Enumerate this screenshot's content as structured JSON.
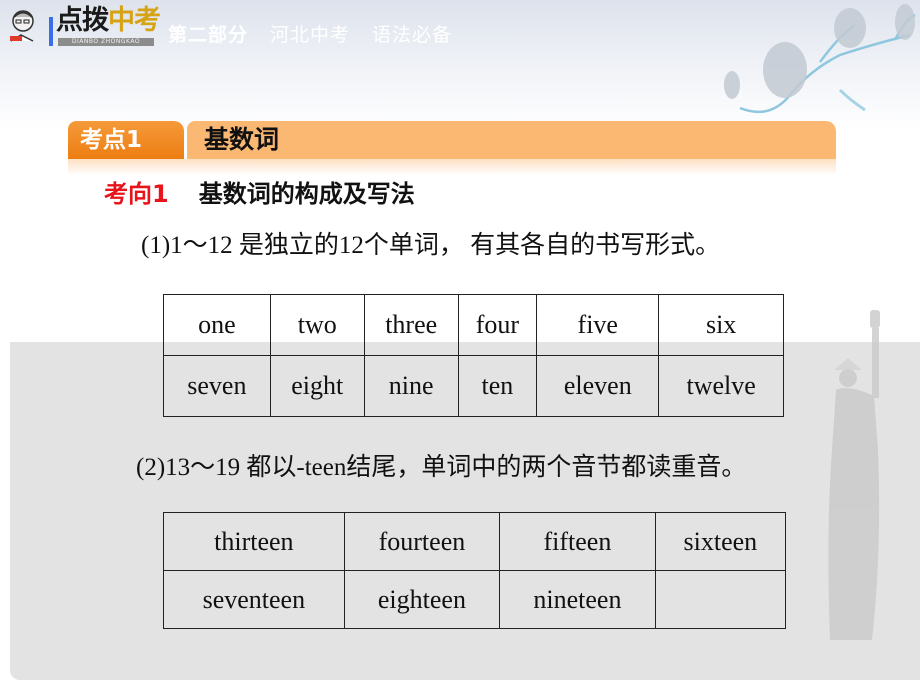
{
  "header": {
    "logo": {
      "main_black": "点拨",
      "main_gold": "中考",
      "subtitle": "DIANBO ZHONGKAO",
      "icon": "cartoon-teacher-icon"
    },
    "nav": [
      "第二部分",
      "河北中考",
      "语法必备"
    ]
  },
  "colors": {
    "accent_orange": "#ed7d12",
    "title_bar_orange": "#fbb872",
    "subhead_red": "#e8141b",
    "logo_blue": "#3a6ee8",
    "logo_gold": "#d6a316"
  },
  "section": {
    "tag": "考点1",
    "title": "基数词"
  },
  "subsection": {
    "tag": "考向1",
    "title": "基数词的构成及写法"
  },
  "paragraphs": {
    "p1": "(1)1～12 是独立的12个单词， 有其各自的书写形式。",
    "p2": "(2)13～19 都以-teen结尾，单词中的两个音节都读重音。"
  },
  "table1": {
    "rows": [
      [
        "one",
        "two",
        "three",
        "four",
        "five",
        "six"
      ],
      [
        "seven",
        "eight",
        "nine",
        "ten",
        "eleven",
        "twelve"
      ]
    ]
  },
  "table2": {
    "rows": [
      [
        "thirteen",
        "fourteen",
        "fifteen",
        "sixteen"
      ],
      [
        "seventeen",
        "eighteen",
        "nineteen",
        ""
      ]
    ]
  }
}
